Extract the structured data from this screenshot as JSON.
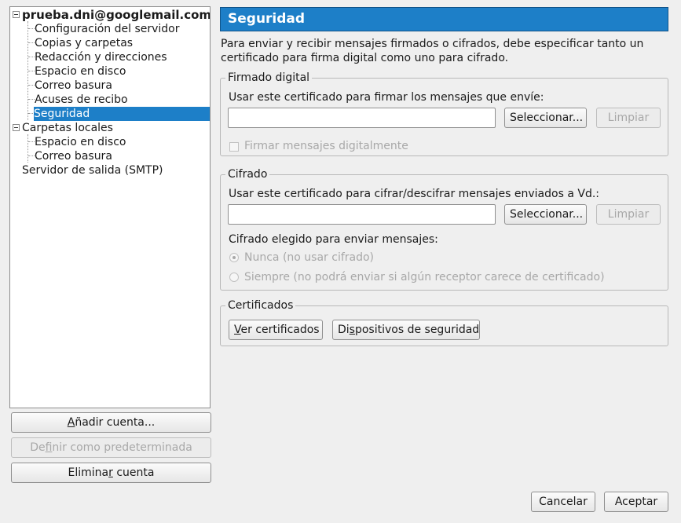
{
  "tree": {
    "account": "prueba.dni@googlemail.com",
    "account_children": [
      "Configuración del servidor",
      "Copias y carpetas",
      "Redacción y direcciones",
      "Espacio en disco",
      "Correo basura",
      "Acuses de recibo",
      "Seguridad"
    ],
    "local_folders": "Carpetas locales",
    "local_children": [
      "Espacio en disco",
      "Correo basura"
    ],
    "smtp": "Servidor de salida (SMTP)",
    "selected": "Seguridad"
  },
  "left_buttons": {
    "add_account": "Añadir cuenta...",
    "set_default": "Definir como predeterminada",
    "delete_account": "Eliminar cuenta"
  },
  "panel": {
    "title": "Seguridad",
    "intro": "Para enviar y recibir mensajes firmados o cifrados, debe especificar tanto un certificado para firma digital como uno para cifrado.",
    "signing": {
      "legend": "Firmado digital",
      "label": "Usar este certificado para firmar los mensajes que envíe:",
      "value": "",
      "select_btn": "Seleccionar...",
      "clear_btn": "Limpiar",
      "sign_checkbox": "Firmar mensajes digitalmente",
      "sign_checked": false
    },
    "encryption": {
      "legend": "Cifrado",
      "label": "Usar este certificado para cifrar/descifrar mensajes enviados a Vd.:",
      "value": "",
      "select_btn": "Seleccionar...",
      "clear_btn": "Limpiar",
      "choice_label": "Cifrado elegido para enviar mensajes:",
      "option_never": "Nunca (no usar cifrado)",
      "option_always": "Siempre (no podrá enviar si algún receptor carece de certificado)",
      "selected_option": "never"
    },
    "certificates": {
      "legend": "Certificados",
      "view_btn": "Ver certificados",
      "devices_btn": "Dispositivos de seguridad"
    }
  },
  "footer": {
    "cancel": "Cancelar",
    "accept": "Aceptar"
  },
  "colors": {
    "accent": "#1d7fc8",
    "background": "#efefef"
  }
}
